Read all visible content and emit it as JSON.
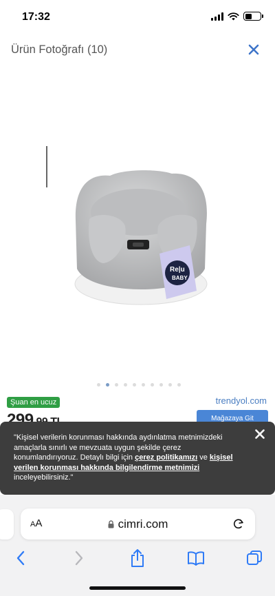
{
  "status_bar": {
    "time": "17:32"
  },
  "header": {
    "title": "Ürün Fotoğrafı (10)"
  },
  "product_image": {
    "logo_text_top": "Re|u",
    "logo_text_bottom": "BABY"
  },
  "carousel": {
    "total": 10,
    "active_index": 1
  },
  "offer": {
    "badge": "Şuan en ucuz",
    "price_main": "299",
    "price_decimal": ",99 TL",
    "store": "trendyol.com",
    "store_button": "Mağazaya Git"
  },
  "cookie": {
    "line1": "\"Kişisel verilerin korunması hakkında aydınlatma metnimizdeki amaçlarla sınırlı ve mevzuata uygun şekilde çerez konumlandırıyoruz. Detaylı bilgi için ",
    "link1": "çerez politikamızı",
    "mid": " ve ",
    "link2": "kişisel verilen korunması hakkında bilgilendirme metnimizi",
    "end": " inceleyebilirsiniz.\""
  },
  "browser": {
    "aa_small": "A",
    "aa_big": "A",
    "url": "cimri.com"
  },
  "colors": {
    "badge": "#2f9e44",
    "store_link": "#4a7ec2",
    "store_button": "#4a86d6",
    "banner": "#3d3d3d",
    "ios_blue": "#2f7bf6"
  }
}
